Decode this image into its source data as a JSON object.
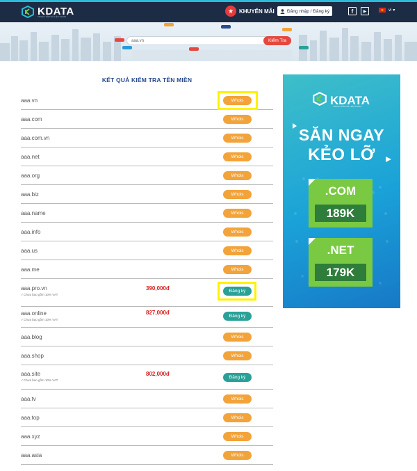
{
  "header": {
    "logo": "KDATA",
    "logo_tagline": "TRUNG TÂM DỮ LIỆU KDATA",
    "promo_label": "KHUYẾN MÃI",
    "login_label": "Đăng nhập / Đăng ký",
    "facebook_glyph": "f",
    "youtube_glyph": "▶",
    "language": "vi"
  },
  "search": {
    "value": "aaa.vn",
    "button_label": "Kiểm Tra"
  },
  "results": {
    "title": "KẾT QUẢ KIỂM TRA TÊN MIỀN",
    "rows": [
      {
        "domain": "aaa.vn",
        "vat": "",
        "price": "",
        "action": "Whois"
      },
      {
        "domain": "aaa.com",
        "vat": "",
        "price": "",
        "action": "Whois"
      },
      {
        "domain": "aaa.com.vn",
        "vat": "",
        "price": "",
        "action": "Whois"
      },
      {
        "domain": "aaa.net",
        "vat": "",
        "price": "",
        "action": "Whois"
      },
      {
        "domain": "aaa.org",
        "vat": "",
        "price": "",
        "action": "Whois"
      },
      {
        "domain": "aaa.biz",
        "vat": "",
        "price": "",
        "action": "Whois"
      },
      {
        "domain": "aaa.name",
        "vat": "",
        "price": "",
        "action": "Whois"
      },
      {
        "domain": "aaa.info",
        "vat": "",
        "price": "",
        "action": "Whois"
      },
      {
        "domain": "aaa.us",
        "vat": "",
        "price": "",
        "action": "Whois"
      },
      {
        "domain": "aaa.me",
        "vat": "",
        "price": "",
        "action": "Whois"
      },
      {
        "domain": "aaa.pro.vn",
        "vat": "✓Chưa bao gồm 10% VAT",
        "price": "390,000đ",
        "action": "Đăng ký"
      },
      {
        "domain": "aaa.online",
        "vat": "✓Chưa bao gồm 10% VAT",
        "price": "827,000đ",
        "action": "Đăng ký"
      },
      {
        "domain": "aaa.blog",
        "vat": "",
        "price": "",
        "action": "Whois"
      },
      {
        "domain": "aaa.shop",
        "vat": "",
        "price": "",
        "action": "Whois"
      },
      {
        "domain": "aaa.site",
        "vat": "✓Chưa bao gồm 10% VAT",
        "price": "802,000đ",
        "action": "Đăng ký"
      },
      {
        "domain": "aaa.tv",
        "vat": "",
        "price": "",
        "action": "Whois"
      },
      {
        "domain": "aaa.top",
        "vat": "",
        "price": "",
        "action": "Whois"
      },
      {
        "domain": "aaa.xyz",
        "vat": "",
        "price": "",
        "action": "Whois"
      },
      {
        "domain": "aaa.asia",
        "vat": "",
        "price": "",
        "action": "Whois"
      }
    ]
  },
  "ad": {
    "logo": "KDATA",
    "logo_tagline": "TRUNG TÂM DỮ LIỆU KDATA",
    "headline_1": "SĂN NGAY",
    "headline_2": "KẺO LỠ",
    "offers": [
      {
        "ext": ".COM",
        "price": "189K"
      },
      {
        "ext": ".NET",
        "price": "179K"
      }
    ]
  },
  "colors": {
    "topbar": "#1d2c45",
    "whois": "#f2a33a",
    "register": "#2aa198",
    "price": "#d51f1f",
    "highlight": "#fff200",
    "title": "#2a4b8d"
  }
}
